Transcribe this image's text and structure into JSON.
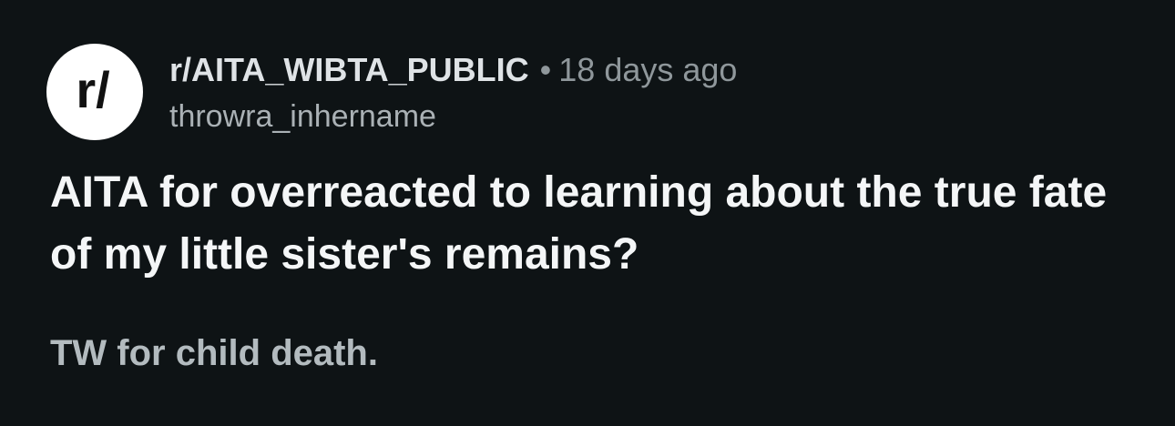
{
  "post": {
    "avatar_icon": "reddit-community-r-slash-icon",
    "avatar_text": "r/",
    "subreddit": "r/AITA_WIBTA_PUBLIC",
    "separator": "•",
    "age": "18 days ago",
    "author": "throwra_inhername",
    "title": "AITA for overreacted to learning about the true fate of my little sister's remains?",
    "body": "TW for child death."
  }
}
